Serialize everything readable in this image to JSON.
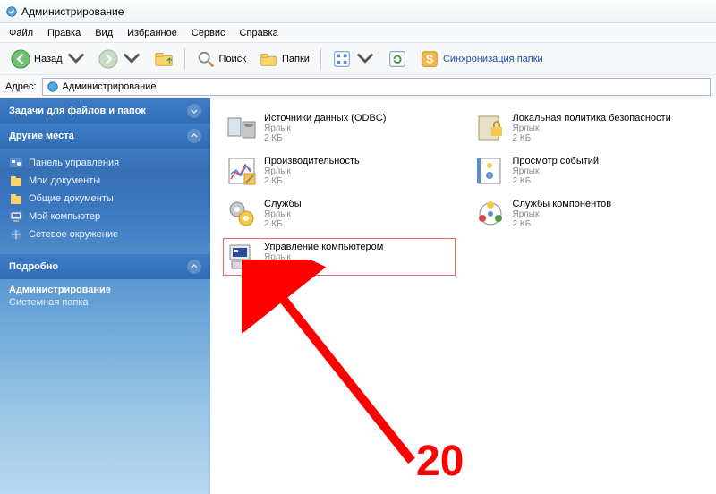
{
  "window": {
    "title": "Администрирование"
  },
  "menu": {
    "items": [
      "Файл",
      "Правка",
      "Вид",
      "Избранное",
      "Сервис",
      "Справка"
    ]
  },
  "toolbar": {
    "back": "Назад",
    "search": "Поиск",
    "folders": "Папки",
    "sync": "Синхронизация папки"
  },
  "address": {
    "label": "Адрес:",
    "value": "Администрирование"
  },
  "sidebar": {
    "panels": {
      "tasks": {
        "title": "Задачи для файлов и папок"
      },
      "places": {
        "title": "Другие места",
        "items": [
          "Панель управления",
          "Мои документы",
          "Общие документы",
          "Мой компьютер",
          "Сетевое окружение"
        ]
      },
      "details": {
        "title": "Подробно",
        "name": "Администрирование",
        "type": "Системная папка"
      }
    }
  },
  "files": {
    "type_label": "Ярлык",
    "size_label": "2 КБ",
    "items": [
      {
        "name": "Источники данных (ODBC)"
      },
      {
        "name": "Локальная политика безопасности"
      },
      {
        "name": "Производительность"
      },
      {
        "name": "Просмотр событий"
      },
      {
        "name": "Службы"
      },
      {
        "name": "Службы компонентов"
      },
      {
        "name": "Управление компьютером"
      }
    ]
  },
  "annotation": {
    "label": "20"
  }
}
